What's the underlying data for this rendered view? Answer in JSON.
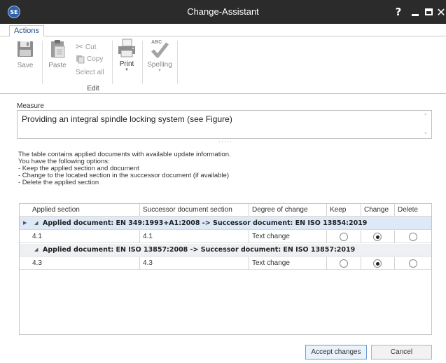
{
  "window": {
    "title": "Change-Assistant",
    "app_logo_text": "SE"
  },
  "ribbon": {
    "tabs": [
      "Actions"
    ],
    "save_label": "Save",
    "paste_label": "Paste",
    "cut_label": "Cut",
    "copy_label": "Copy",
    "select_all_label": "Select all",
    "edit_group_label": "Edit",
    "print_label": "Print",
    "spelling_label": "Spelling",
    "spelling_icon_text": "ABC"
  },
  "measure": {
    "label": "Measure",
    "value": "Providing an integral spindle locking system (see Figure)"
  },
  "info_lines": [
    "The table contains applied documents with available update information.",
    "You have the following options:",
    "- Keep the applied section and document",
    "- Change to the located section in the successor document (if available)",
    "- Delete the applied section"
  ],
  "grid": {
    "columns": [
      "Applied section",
      "Successor document section",
      "Degree of change",
      "Keep",
      "Change",
      "Delete"
    ],
    "groups": [
      {
        "title": "Applied document: EN 349:1993+A1:2008 -> Successor document: EN ISO 13854:2019",
        "rows": [
          {
            "applied": "4.1",
            "successor": "4.1",
            "degree": "Text change",
            "choice": "Change"
          }
        ]
      },
      {
        "title": "Applied document: EN ISO 13857:2008 -> Successor document: EN ISO 13857:2019",
        "rows": [
          {
            "applied": "4.3",
            "successor": "4.3",
            "degree": "Text change",
            "choice": "Change"
          }
        ]
      }
    ]
  },
  "footer": {
    "accept_label": "Accept changes",
    "cancel_label": "Cancel"
  }
}
